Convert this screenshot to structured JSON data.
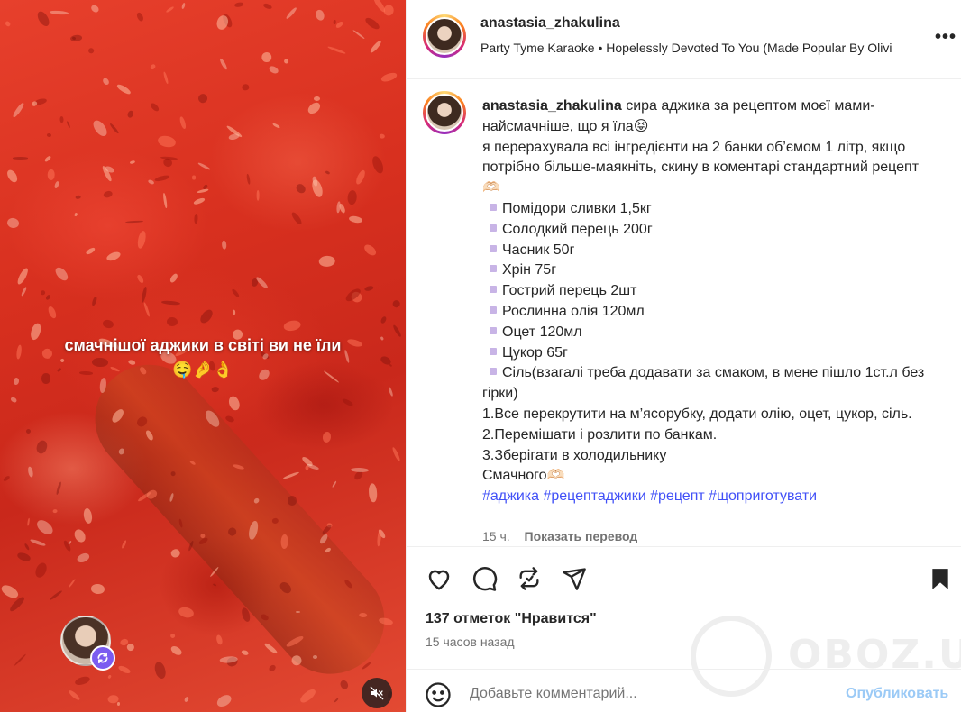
{
  "media": {
    "overlay_text": "смачнішої аджики в світі ви не їли",
    "overlay_emoji": "🤤🤌👌"
  },
  "header": {
    "username": "anastasia_zhakulina",
    "audio": "Party Tyme Karaoke • Hopelessly Devoted To You (Made Popular By Olivi",
    "more_icon": "more-horizontal-icon"
  },
  "caption": {
    "username": "anastasia_zhakulina",
    "intro": "сира аджика за рецептом моєї мами-найсмачніше, що я їла😝",
    "line2": "я перерахувала всі інгредієнти на 2 банки об’ємом 1 літр, якщо потрібно більше-маякніть, скину в коментарі стандартний рецепт🫶🏻",
    "ingredients": [
      "Помідори сливки 1,5кг",
      "Солодкий перець 200г",
      "Часник 50г",
      "Хрін 75г",
      "Гострий перець 2шт",
      "Рослинна олія 120мл",
      "Оцет 120мл",
      "Цукор 65г",
      "Сіль(взагалі треба додавати за смаком, в мене пішло 1ст.л без гірки)"
    ],
    "steps": [
      "1.Все перекрутити на м’ясорубку, додати олію, оцет, цукор, сіль.",
      "2.Перемішати і розлити по банкам.",
      "3.Зберігати в холодильнику"
    ],
    "closing": "Смачного🫶🏻",
    "hashtags": "#аджика #рецептаджики #рецепт #щоприготувати",
    "age": "15 ч.",
    "translate": "Показать перевод"
  },
  "actions": {
    "likes": "137 отметок \"Нравится\"",
    "posted": "15 часов назад"
  },
  "watermark": "OBOZ.UA",
  "comment": {
    "placeholder": "Добавьте комментарий...",
    "publish": "Опубликовать"
  },
  "colors": {
    "link_blue": "#4150f7",
    "publish_disabled": "#9bcaf6",
    "text": "#262626",
    "muted": "#737373"
  }
}
